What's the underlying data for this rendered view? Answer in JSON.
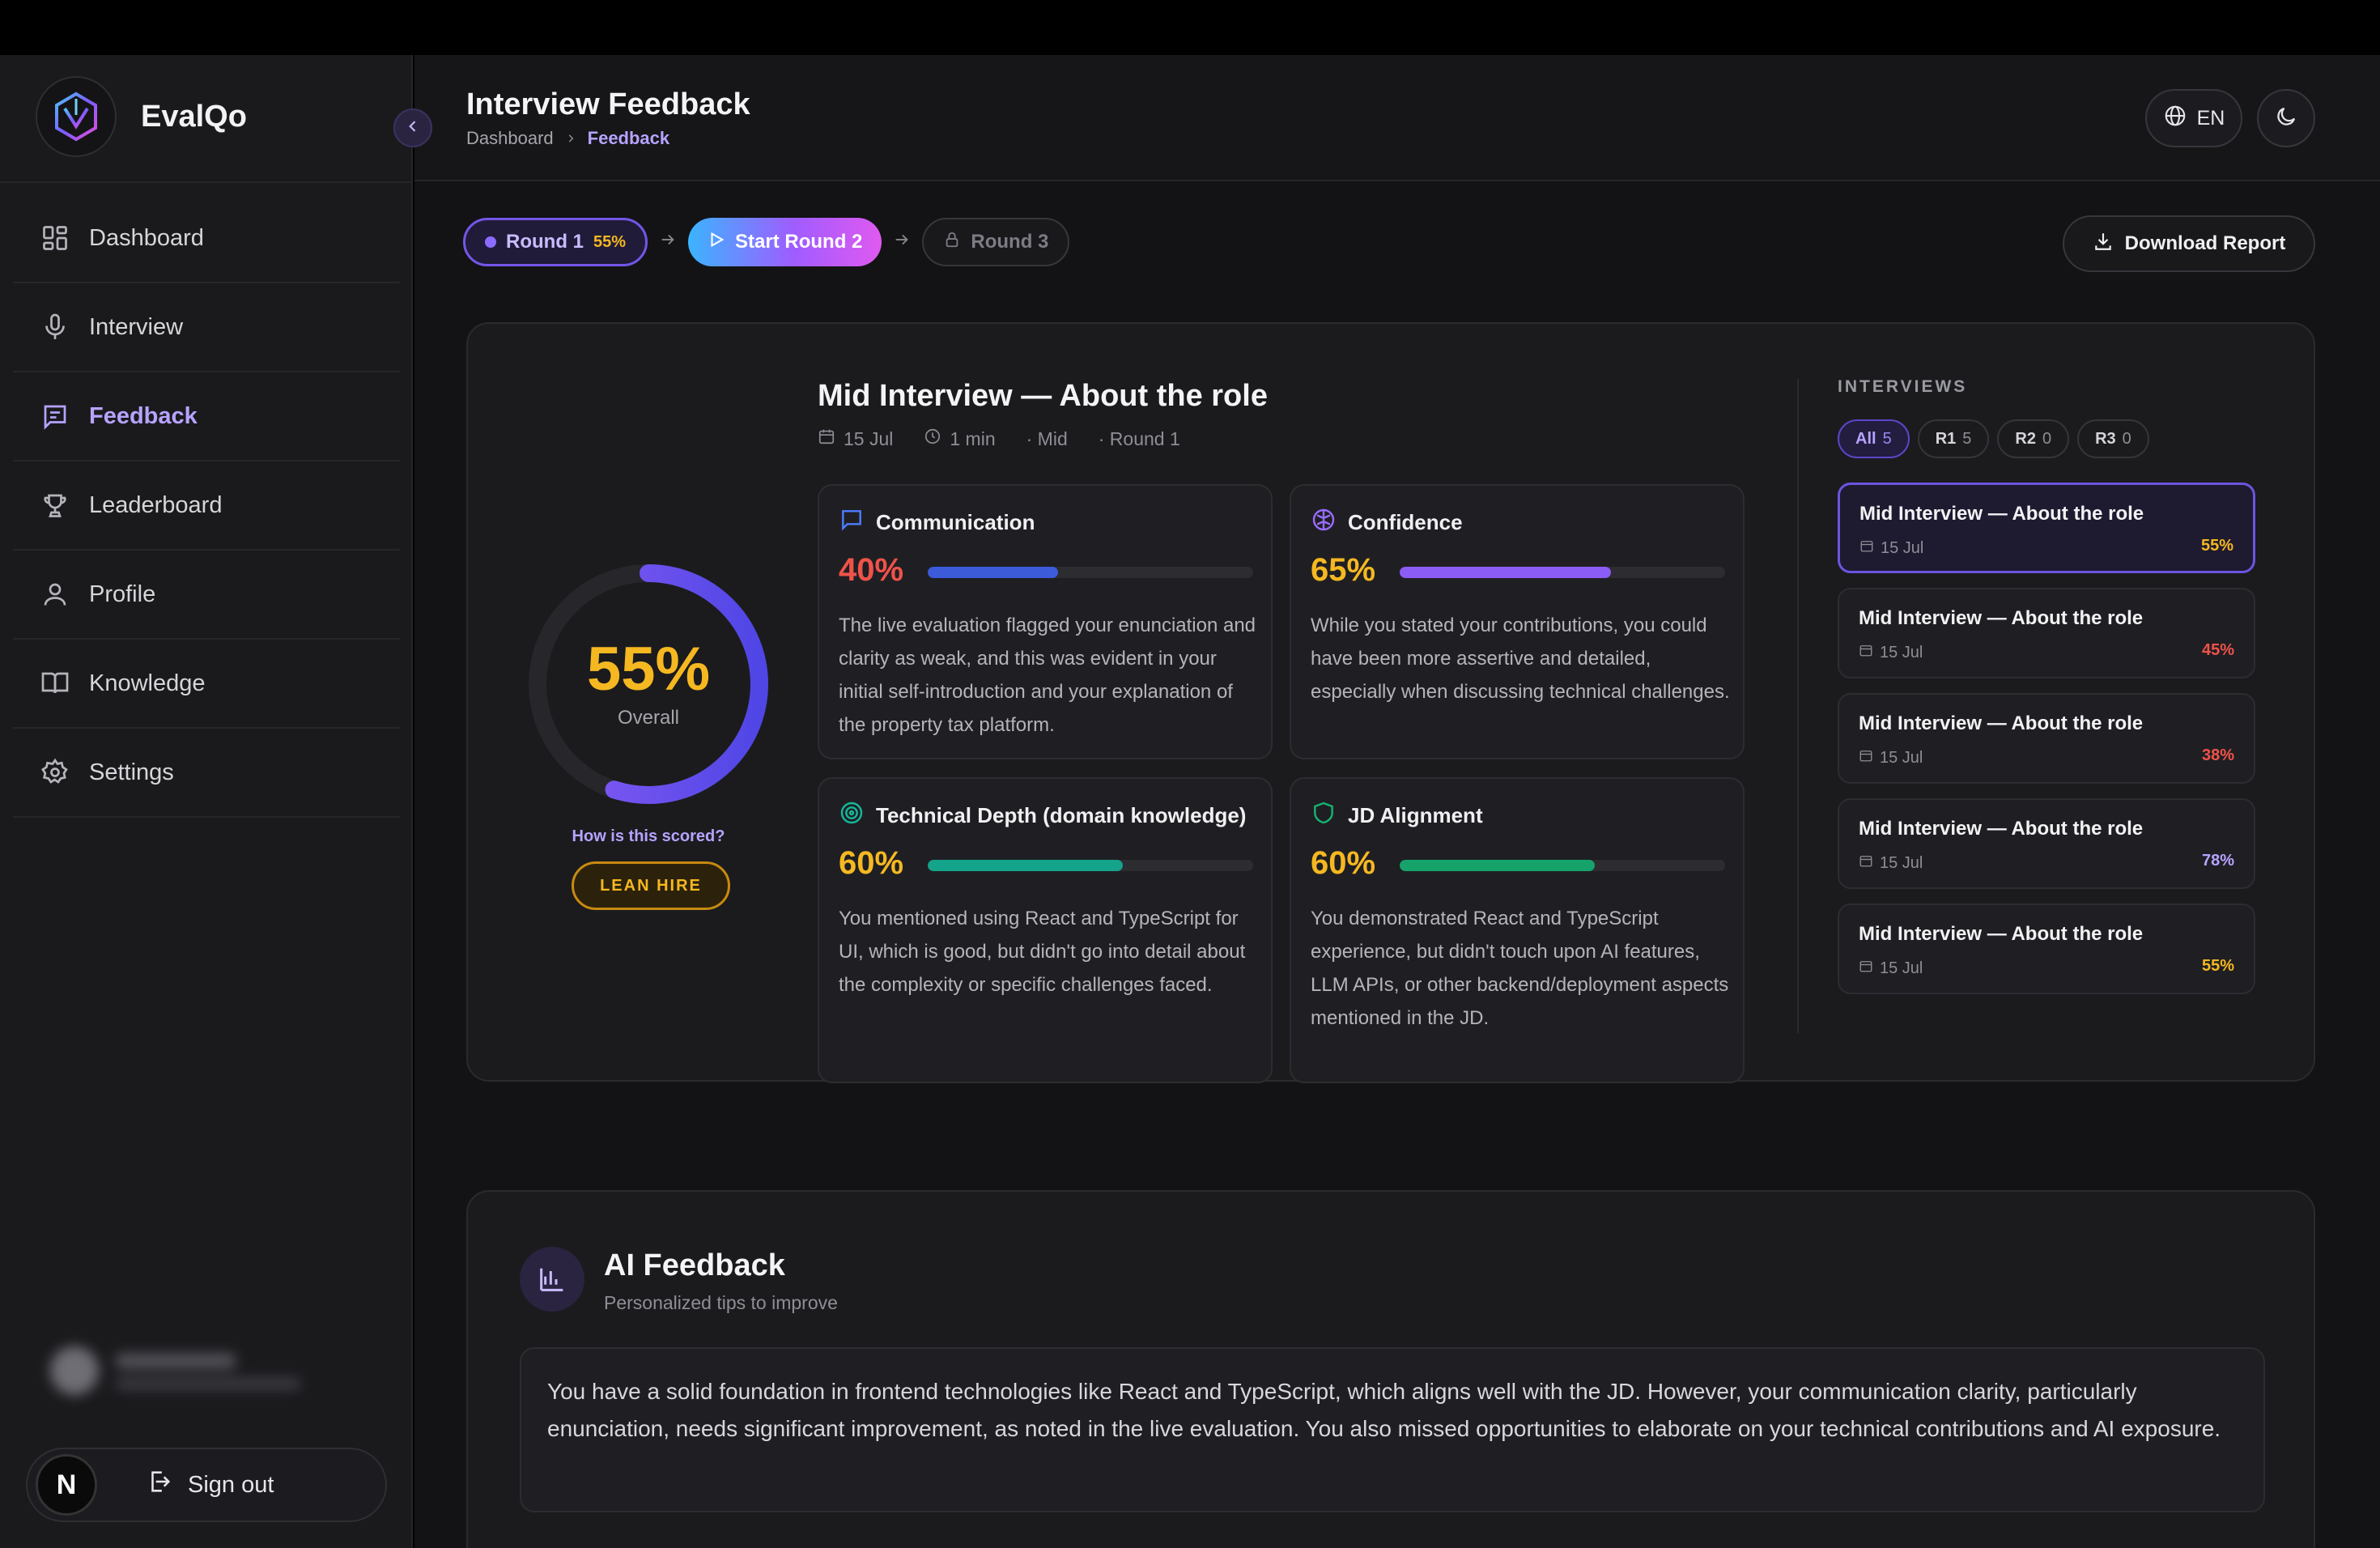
{
  "app": {
    "name": "EvalQo"
  },
  "sidebar": {
    "items": [
      {
        "label": "Dashboard",
        "icon": "grid-icon"
      },
      {
        "label": "Interview",
        "icon": "microphone-icon"
      },
      {
        "label": "Feedback",
        "icon": "message-icon",
        "active": true
      },
      {
        "label": "Leaderboard",
        "icon": "trophy-icon"
      },
      {
        "label": "Profile",
        "icon": "user-icon"
      },
      {
        "label": "Knowledge",
        "icon": "book-icon"
      },
      {
        "label": "Settings",
        "icon": "gear-icon"
      }
    ],
    "avatar_letter": "N",
    "signout_label": "Sign out"
  },
  "header": {
    "title": "Interview Feedback",
    "breadcrumb": [
      "Dashboard",
      "Feedback"
    ],
    "lang": "EN"
  },
  "rounds": {
    "round1": {
      "label": "Round 1",
      "score": "55%"
    },
    "round2": {
      "label": "Start Round 2"
    },
    "round3": {
      "label": "Round 3"
    },
    "download_label": "Download Report"
  },
  "summary": {
    "overall_value": "55%",
    "overall_fraction": 0.55,
    "overall_label": "Overall",
    "how_scored": "How is this scored?",
    "verdict": "LEAN HIRE",
    "title": "Mid Interview — About the role",
    "meta": {
      "date": "15 Jul",
      "duration": "1 min",
      "level": "· Mid",
      "round": "· Round 1"
    }
  },
  "metrics": [
    {
      "name": "Communication",
      "score": "40%",
      "fraction": 0.4,
      "color": "#3b5bdb",
      "score_color": "#f0524a",
      "text": "The live evaluation flagged your enunciation and clarity as weak, and this was evident in your initial self-introduction and your explanation of the property tax platform."
    },
    {
      "name": "Confidence",
      "score": "65%",
      "fraction": 0.65,
      "color": "#8b5cf6",
      "score_color": "#f5b820",
      "text": "While you stated your contributions, you could have been more assertive and detailed, especially when discussing technical challenges."
    },
    {
      "name": "Technical Depth (domain knowledge)",
      "score": "60%",
      "fraction": 0.6,
      "color": "#14a38b",
      "score_color": "#f5b820",
      "text": "You mentioned using React and TypeScript for UI, which is good, but didn't go into detail about the complexity or specific challenges faced."
    },
    {
      "name": "JD Alignment",
      "score": "60%",
      "fraction": 0.6,
      "color": "#16a36b",
      "score_color": "#f5b820",
      "text": "You demonstrated React and TypeScript experience, but didn't touch upon AI features, LLM APIs, or other backend/deployment aspects mentioned in the JD."
    }
  ],
  "interviews": {
    "title": "INTERVIEWS",
    "filters": [
      {
        "label": "All",
        "count": "5",
        "active": true
      },
      {
        "label": "R1",
        "count": "5"
      },
      {
        "label": "R2",
        "count": "0"
      },
      {
        "label": "R3",
        "count": "0"
      }
    ],
    "items": [
      {
        "title": "Mid Interview — About the role",
        "date": "15 Jul",
        "score": "55%",
        "color": "#f5b820",
        "active": true
      },
      {
        "title": "Mid Interview — About the role",
        "date": "15 Jul",
        "score": "45%",
        "color": "#f0524a"
      },
      {
        "title": "Mid Interview — About the role",
        "date": "15 Jul",
        "score": "38%",
        "color": "#f0524a"
      },
      {
        "title": "Mid Interview — About the role",
        "date": "15 Jul",
        "score": "78%",
        "color": "#b7a3ff"
      },
      {
        "title": "Mid Interview — About the role",
        "date": "15 Jul",
        "score": "55%",
        "color": "#f5b820"
      }
    ]
  },
  "ai_feedback": {
    "title": "AI Feedback",
    "subtitle": "Personalized tips to improve",
    "text": "You have a solid foundation in frontend technologies like React and TypeScript, which aligns well with the JD. However, your communication clarity, particularly enunciation, needs significant improvement, as noted in the live evaluation. You also missed opportunities to elaborate on your technical contributions and AI exposure."
  }
}
